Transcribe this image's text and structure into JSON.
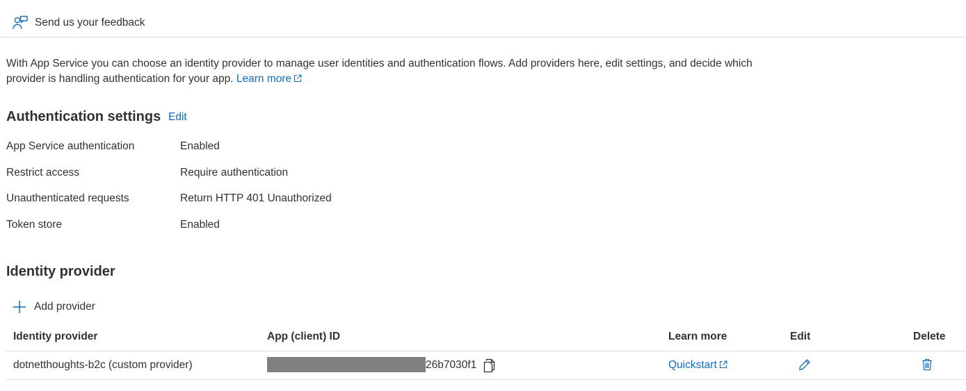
{
  "toolbar": {
    "feedback_label": "Send us your feedback"
  },
  "intro": {
    "text": "With App Service you can choose an identity provider to manage user identities and authentication flows. Add providers here, edit settings, and decide which provider is handling authentication for your app.",
    "learn_more": "Learn more"
  },
  "auth_settings": {
    "title": "Authentication settings",
    "edit_label": "Edit",
    "rows": [
      {
        "label": "App Service authentication",
        "value": "Enabled"
      },
      {
        "label": "Restrict access",
        "value": "Require authentication"
      },
      {
        "label": "Unauthenticated requests",
        "value": "Return HTTP 401 Unauthorized"
      },
      {
        "label": "Token store",
        "value": "Enabled"
      }
    ]
  },
  "identity_provider": {
    "title": "Identity provider",
    "add_label": "Add provider",
    "columns": [
      "Identity provider",
      "App (client) ID",
      "Learn more",
      "Edit",
      "Delete"
    ],
    "rows": [
      {
        "provider": "dotnetthoughts-b2c (custom provider)",
        "client_id_suffix": "26b7030f1",
        "learn_more": "Quickstart"
      }
    ]
  },
  "colors": {
    "link": "#0f6cbd",
    "text": "#323130",
    "divider": "#e1dfdd",
    "redaction": "#808080"
  },
  "icons": {
    "feedback": "feedback-person-icon",
    "external": "external-link-icon",
    "add": "plus-icon",
    "copy": "copy-icon",
    "edit": "pencil-icon",
    "delete": "trash-icon"
  }
}
